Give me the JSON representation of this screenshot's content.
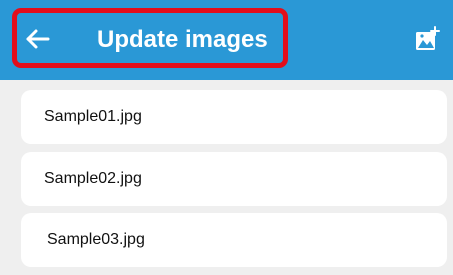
{
  "header": {
    "title": "Update images",
    "back_icon": "arrow-left-icon",
    "action_icon": "add-photo-icon",
    "background_color": "#2a98d6",
    "highlight_color": "#e30d1b"
  },
  "images": {
    "items": [
      {
        "filename": "Sample01.jpg"
      },
      {
        "filename": "Sample02.jpg"
      },
      {
        "filename": "Sample03.jpg"
      }
    ]
  }
}
